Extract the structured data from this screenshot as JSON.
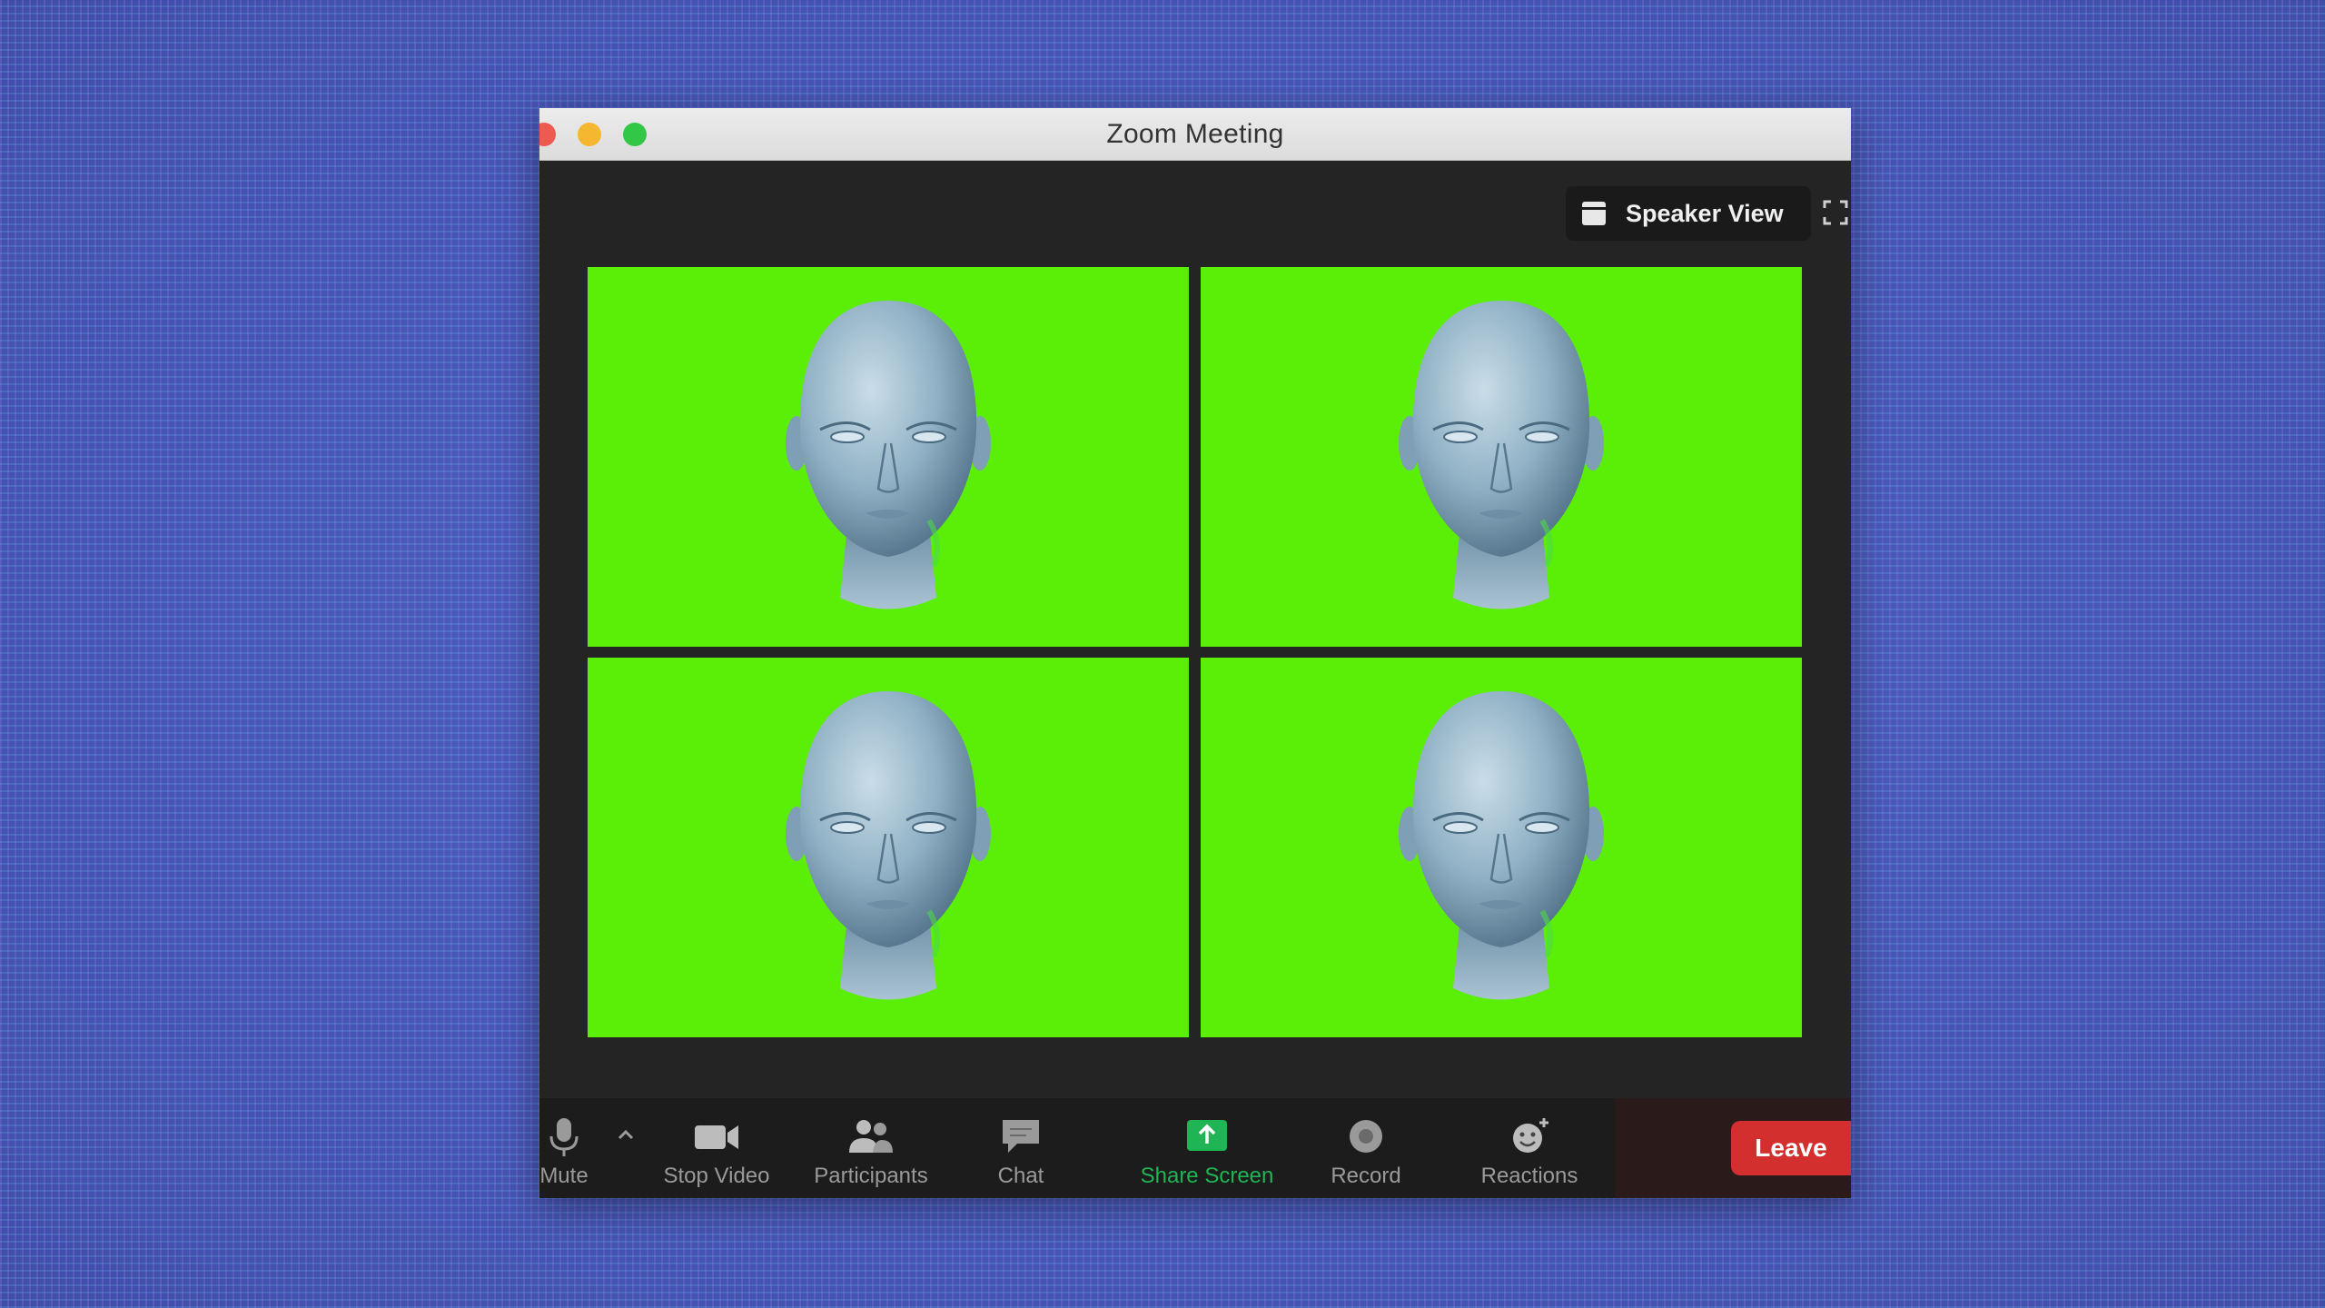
{
  "window": {
    "title": "Zoom Meeting"
  },
  "view": {
    "speaker_view_label": "Speaker View"
  },
  "tiles": [
    {
      "name": "tile-1"
    },
    {
      "name": "tile-2"
    },
    {
      "name": "tile-3"
    },
    {
      "name": "tile-4"
    }
  ],
  "toolbar": {
    "mute_label": "Mute",
    "stop_video_label": "Stop Video",
    "participants_label": "Participants",
    "chat_label": "Chat",
    "share_screen_label": "Share Screen",
    "record_label": "Record",
    "reactions_label": "Reactions",
    "leave_label": "Leave"
  },
  "colors": {
    "tile_background": "#5bee07",
    "share_accent": "#1fb454",
    "leave": "#d32f2f"
  },
  "icons": [
    "microphone-icon",
    "caret-up-icon",
    "video-camera-icon",
    "participants-icon",
    "chat-icon",
    "share-screen-icon",
    "record-icon",
    "reactions-icon",
    "speaker-view-icon",
    "fullscreen-icon"
  ]
}
